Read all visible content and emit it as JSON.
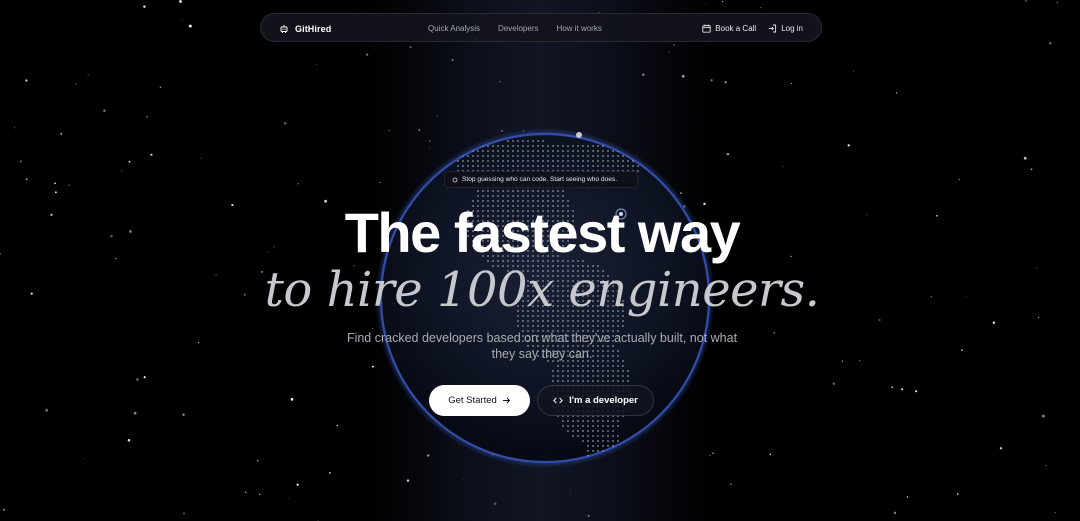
{
  "brand": {
    "name": "GitHired",
    "logo_icon": "robot-icon"
  },
  "nav": {
    "links": [
      "Quick Analysis",
      "Developers",
      "How it works"
    ],
    "book_call": "Book a Call",
    "login": "Log in"
  },
  "tagline": "Stop guessing who can code. Start seeing who does.",
  "hero": {
    "title": "The fastest way",
    "subtitle": "to hire 100x engineers.",
    "description": "Find cracked developers based on what they've actually built, not what they say they can."
  },
  "cta": {
    "primary": "Get Started",
    "secondary": "I'm a developer"
  },
  "colors": {
    "background": "#000000",
    "globe_glow": "#2f4fae",
    "primary_button": "#ffffff"
  }
}
